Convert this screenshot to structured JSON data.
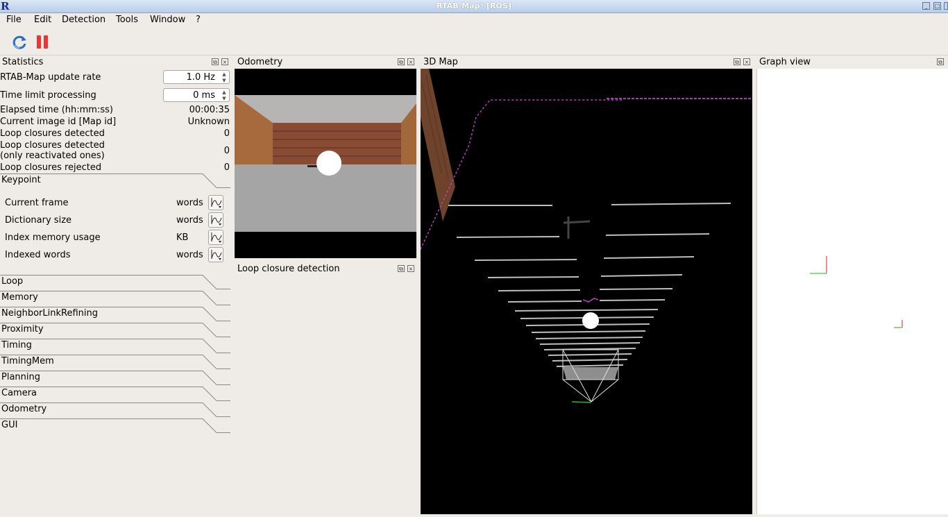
{
  "window": {
    "title": "RTAB-Map* [ROS]",
    "logo": "R"
  },
  "menu": [
    "File",
    "Edit",
    "Detection",
    "Tools",
    "Window",
    "?"
  ],
  "toolbar": {
    "icons": [
      "refresh-icon",
      "pause-icon"
    ]
  },
  "statistics": {
    "title": "Statistics",
    "update_rate_label": "RTAB-Map update rate",
    "update_rate_value": "1.0 Hz",
    "time_limit_label": "Time limit processing",
    "time_limit_value": "0 ms",
    "rows": [
      {
        "label": "Elapsed time (hh:mm:ss)",
        "value": "00:00:35"
      },
      {
        "label": "Current image id [Map id]",
        "value": "Unknown"
      },
      {
        "label": "Loop closures detected",
        "value": "0"
      },
      {
        "label": "Loop closures detected\n(only reactivated ones)",
        "value": "0"
      },
      {
        "label": "Loop closures rejected",
        "value": "0"
      }
    ],
    "keypoint": {
      "title": "Keypoint",
      "rows": [
        {
          "label": "Current frame",
          "unit": "words"
        },
        {
          "label": "Dictionary size",
          "unit": "words"
        },
        {
          "label": "Index memory usage",
          "unit": "KB"
        },
        {
          "label": "Indexed words",
          "unit": "words"
        }
      ]
    },
    "sections": [
      "Loop",
      "Memory",
      "NeighborLinkRefining",
      "Proximity",
      "Timing",
      "TimingMem",
      "Planning",
      "Camera",
      "Odometry",
      "GUI"
    ]
  },
  "odometry": {
    "title": "Odometry"
  },
  "loop_closure": {
    "title": "Loop closure detection"
  },
  "map3d": {
    "title": "3D Map"
  },
  "graph": {
    "title": "Graph view"
  },
  "colors": {
    "titlebar": "#c6d6ee",
    "background": "#efebe7",
    "map_bg": "#000000",
    "graph_bg": "#ffffff"
  }
}
